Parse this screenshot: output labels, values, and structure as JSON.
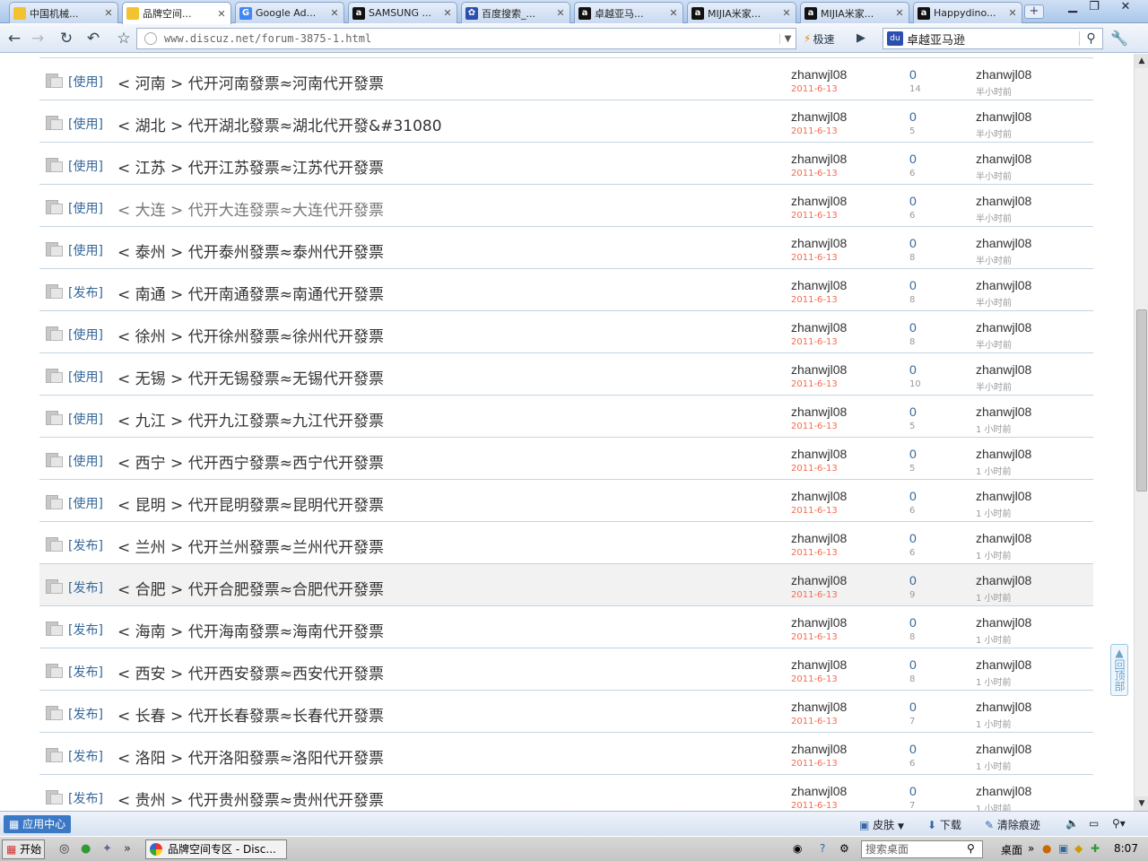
{
  "tabs": [
    {
      "title": "中国机械...",
      "icon": "folder-icon",
      "color": "#f2c230",
      "active": false
    },
    {
      "title": "品牌空间...",
      "icon": "discuz-icon",
      "color": "#f2c230",
      "active": true
    },
    {
      "title": "Google Ad...",
      "icon": "google-icon",
      "color": "#4285f4",
      "active": false
    },
    {
      "title": "SAMSUNG ...",
      "icon": "amazon-icon",
      "color": "#111111",
      "active": false
    },
    {
      "title": "百度搜索_...",
      "icon": "baidu-icon",
      "color": "#2b4fae",
      "active": false
    },
    {
      "title": "卓越亚马...",
      "icon": "amazon-icon",
      "color": "#111111",
      "active": false
    },
    {
      "title": "MIJIA米家...",
      "icon": "amazon-icon",
      "color": "#111111",
      "active": false
    },
    {
      "title": "MIJIA米家...",
      "icon": "amazon-icon",
      "color": "#111111",
      "active": false
    },
    {
      "title": "Happydino...",
      "icon": "amazon-icon",
      "color": "#111111",
      "active": false
    }
  ],
  "toolbar": {
    "url": "www.discuz.net/forum-3875-1.html",
    "speed_label": "极速",
    "search_text": "卓越亚马逊"
  },
  "threads": [
    {
      "tag": "[使用]",
      "subject": "< 河南 > 代开河南發票≈河南代开發票",
      "author": "zhanwjl08",
      "date": "2011-6-13",
      "replies": "0",
      "views": "14",
      "last_author": "zhanwjl08",
      "last_time": "半小时前",
      "visited": false
    },
    {
      "tag": "[使用]",
      "subject": "< 湖北 > 代开湖北發票≈湖北代开發&#31080",
      "author": "zhanwjl08",
      "date": "2011-6-13",
      "replies": "0",
      "views": "5",
      "last_author": "zhanwjl08",
      "last_time": "半小时前",
      "visited": false
    },
    {
      "tag": "[使用]",
      "subject": "< 江苏 > 代开江苏發票≈江苏代开發票",
      "author": "zhanwjl08",
      "date": "2011-6-13",
      "replies": "0",
      "views": "6",
      "last_author": "zhanwjl08",
      "last_time": "半小时前",
      "visited": false
    },
    {
      "tag": "[使用]",
      "subject": "< 大连 > 代开大连發票≈大连代开發票",
      "author": "zhanwjl08",
      "date": "2011-6-13",
      "replies": "0",
      "views": "6",
      "last_author": "zhanwjl08",
      "last_time": "半小时前",
      "visited": true
    },
    {
      "tag": "[使用]",
      "subject": "< 泰州 > 代开泰州發票≈泰州代开發票",
      "author": "zhanwjl08",
      "date": "2011-6-13",
      "replies": "0",
      "views": "8",
      "last_author": "zhanwjl08",
      "last_time": "半小时前",
      "visited": false
    },
    {
      "tag": "[发布]",
      "subject": "< 南通 > 代开南通發票≈南通代开發票",
      "author": "zhanwjl08",
      "date": "2011-6-13",
      "replies": "0",
      "views": "8",
      "last_author": "zhanwjl08",
      "last_time": "半小时前",
      "visited": false
    },
    {
      "tag": "[使用]",
      "subject": "< 徐州 > 代开徐州發票≈徐州代开發票",
      "author": "zhanwjl08",
      "date": "2011-6-13",
      "replies": "0",
      "views": "8",
      "last_author": "zhanwjl08",
      "last_time": "半小时前",
      "visited": false
    },
    {
      "tag": "[使用]",
      "subject": "< 无锡 > 代开无锡發票≈无锡代开發票",
      "author": "zhanwjl08",
      "date": "2011-6-13",
      "replies": "0",
      "views": "10",
      "last_author": "zhanwjl08",
      "last_time": "半小时前",
      "visited": false
    },
    {
      "tag": "[使用]",
      "subject": "< 九江 > 代开九江發票≈九江代开發票",
      "author": "zhanwjl08",
      "date": "2011-6-13",
      "replies": "0",
      "views": "5",
      "last_author": "zhanwjl08",
      "last_time": "1 小时前",
      "visited": false
    },
    {
      "tag": "[使用]",
      "subject": "< 西宁 > 代开西宁發票≈西宁代开發票",
      "author": "zhanwjl08",
      "date": "2011-6-13",
      "replies": "0",
      "views": "5",
      "last_author": "zhanwjl08",
      "last_time": "1 小时前",
      "visited": false
    },
    {
      "tag": "[使用]",
      "subject": "< 昆明 > 代开昆明發票≈昆明代开發票",
      "author": "zhanwjl08",
      "date": "2011-6-13",
      "replies": "0",
      "views": "6",
      "last_author": "zhanwjl08",
      "last_time": "1 小时前",
      "visited": false
    },
    {
      "tag": "[发布]",
      "subject": "< 兰州 > 代开兰州發票≈兰州代开發票",
      "author": "zhanwjl08",
      "date": "2011-6-13",
      "replies": "0",
      "views": "6",
      "last_author": "zhanwjl08",
      "last_time": "1 小时前",
      "visited": false
    },
    {
      "tag": "[发布]",
      "subject": "< 合肥 > 代开合肥發票≈合肥代开發票",
      "author": "zhanwjl08",
      "date": "2011-6-13",
      "replies": "0",
      "views": "9",
      "last_author": "zhanwjl08",
      "last_time": "1 小时前",
      "visited": false,
      "highlight": true
    },
    {
      "tag": "[发布]",
      "subject": "< 海南 > 代开海南發票≈海南代开發票",
      "author": "zhanwjl08",
      "date": "2011-6-13",
      "replies": "0",
      "views": "8",
      "last_author": "zhanwjl08",
      "last_time": "1 小时前",
      "visited": false
    },
    {
      "tag": "[发布]",
      "subject": "< 西安 > 代开西安發票≈西安代开發票",
      "author": "zhanwjl08",
      "date": "2011-6-13",
      "replies": "0",
      "views": "8",
      "last_author": "zhanwjl08",
      "last_time": "1 小时前",
      "visited": false
    },
    {
      "tag": "[发布]",
      "subject": "< 长春 > 代开长春發票≈长春代开發票",
      "author": "zhanwjl08",
      "date": "2011-6-13",
      "replies": "0",
      "views": "7",
      "last_author": "zhanwjl08",
      "last_time": "1 小时前",
      "visited": false
    },
    {
      "tag": "[发布]",
      "subject": "< 洛阳 > 代开洛阳發票≈洛阳代开發票",
      "author": "zhanwjl08",
      "date": "2011-6-13",
      "replies": "0",
      "views": "6",
      "last_author": "zhanwjl08",
      "last_time": "1 小时前",
      "visited": false
    },
    {
      "tag": "[发布]",
      "subject": "< 贵州 > 代开贵州發票≈贵州代开發票",
      "author": "zhanwjl08",
      "date": "2011-6-13",
      "replies": "0",
      "views": "7",
      "last_author": "zhanwjl08",
      "last_time": "1 小时前",
      "visited": false
    }
  ],
  "back_to_top": "回顶部",
  "statusbar": {
    "app_center": "应用中心",
    "skin": "皮肤",
    "download": "下载",
    "clear_traces": "清除痕迹"
  },
  "taskbar": {
    "start": "开始",
    "task_title": "品牌空间专区 - Disc...",
    "desktop_search_placeholder": "搜索桌面",
    "desktop_label": "桌面",
    "clock": "8:07"
  }
}
